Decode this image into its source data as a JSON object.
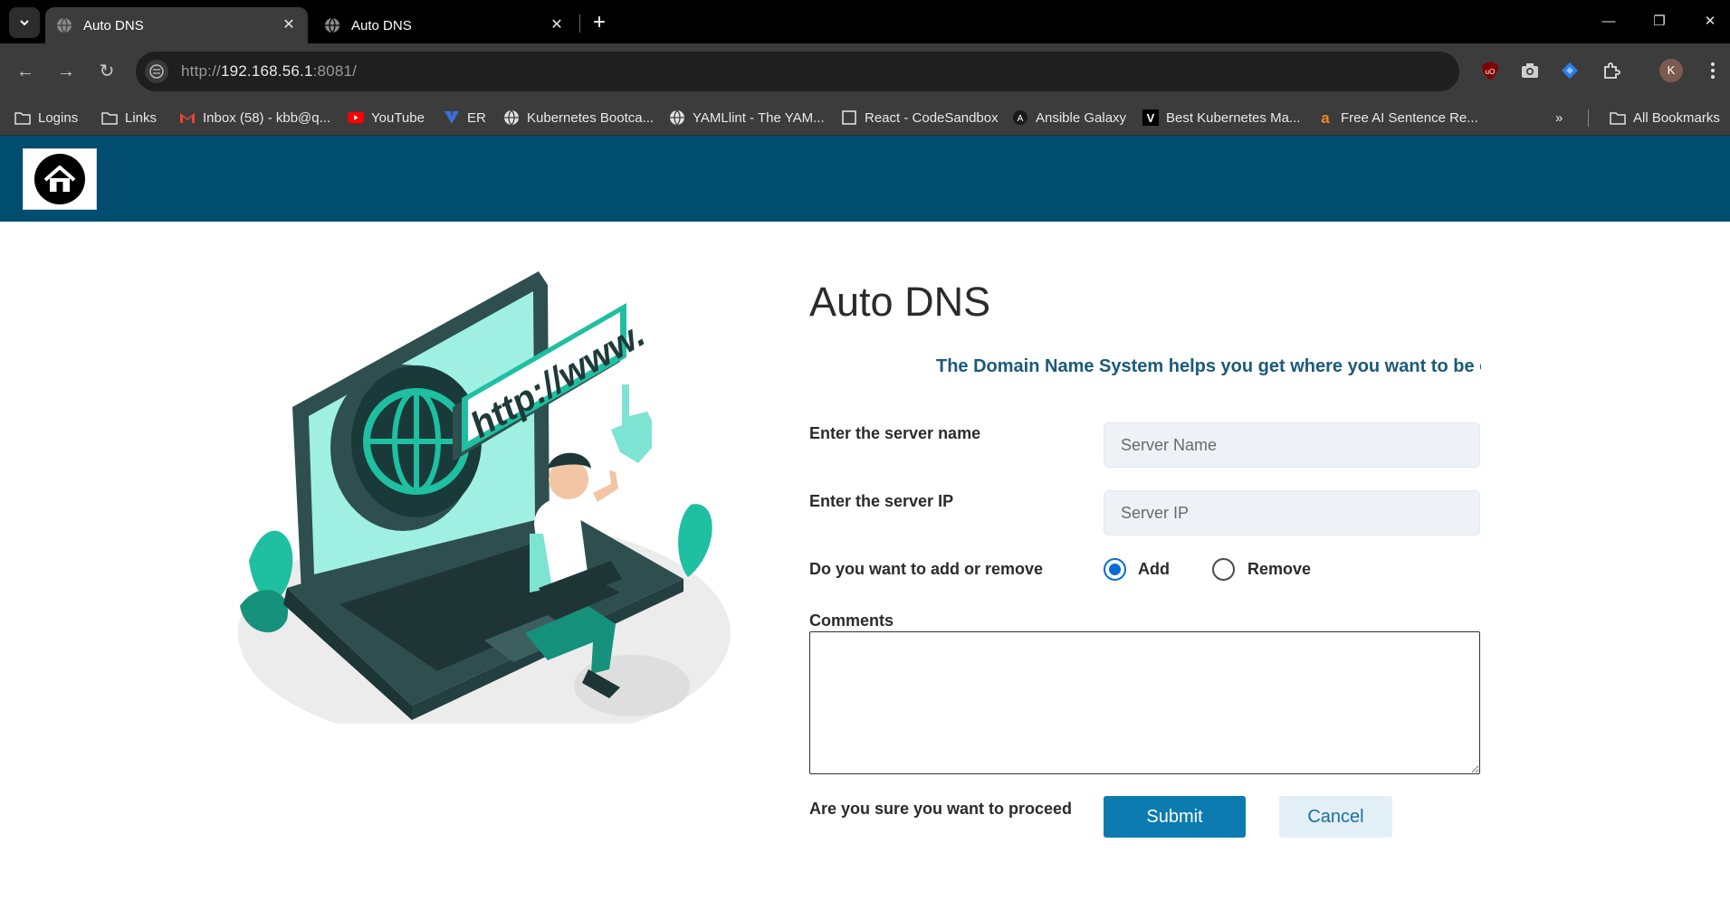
{
  "browser": {
    "tabs": [
      {
        "title": "Auto DNS",
        "active": true
      },
      {
        "title": "Auto DNS",
        "active": false
      }
    ],
    "url_scheme": "http://",
    "url_host": "192.168.56.1",
    "url_rest": ":8081/",
    "profile_initial": "K",
    "bookmarks": [
      {
        "label": "Logins",
        "icon": "folder-icon"
      },
      {
        "label": "Links",
        "icon": "folder-icon"
      },
      {
        "label": "Inbox (58) - kbb@q...",
        "icon": "gmail-icon"
      },
      {
        "label": "YouTube",
        "icon": "youtube-icon"
      },
      {
        "label": "ER",
        "icon": "er-icon"
      },
      {
        "label": "Kubernetes Bootca...",
        "icon": "globe-icon"
      },
      {
        "label": "YAMLlint - The YAM...",
        "icon": "globe-icon"
      },
      {
        "label": "React - CodeSandbox",
        "icon": "codesandbox-icon"
      },
      {
        "label": "Ansible Galaxy",
        "icon": "ansible-icon"
      },
      {
        "label": "Best Kubernetes Ma...",
        "icon": "v-icon"
      },
      {
        "label": "Free AI Sentence Re...",
        "icon": "a-icon"
      }
    ],
    "all_bookmarks": "All Bookmarks"
  },
  "page": {
    "title": "Auto DNS",
    "marquee": "The Domain Name System helps you get where you want to be o",
    "illustration_text": "http://www.",
    "form": {
      "server_name_label": "Enter the server name",
      "server_name_placeholder": "Server Name",
      "server_ip_label": "Enter the server IP",
      "server_ip_placeholder": "Server IP",
      "action_label": "Do you want to add or remove",
      "options": [
        {
          "label": "Add",
          "checked": true
        },
        {
          "label": "Remove",
          "checked": false
        }
      ],
      "comments_label": "Comments",
      "comments_value": "",
      "proceed_label": "Are you sure you want to proceed",
      "submit_label": "Submit",
      "cancel_label": "Cancel"
    }
  },
  "colors": {
    "header": "#004d70",
    "accent": "#0c7bb0",
    "illustration_teal": "#1fbfa2"
  }
}
